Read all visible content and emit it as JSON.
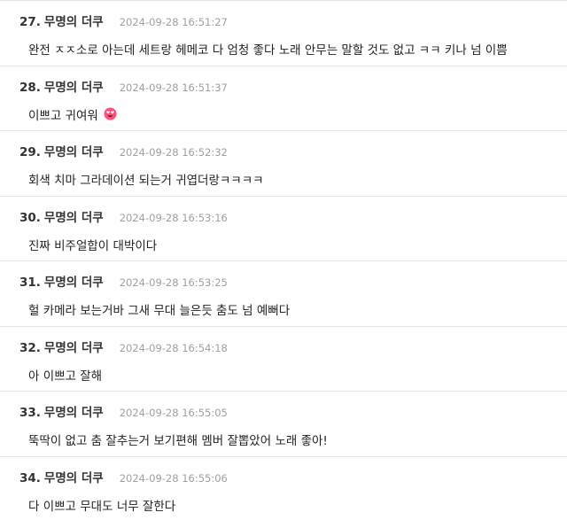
{
  "comments": [
    {
      "number": "27.",
      "author": "무명의 더쿠",
      "date": "2024-09-28 16:51:27",
      "text": "완전 ㅈㅈ소로 아는데 세트랑 헤메코 다 엄청 좋다 노래 안무는 말할 것도 없고 ㅋㅋ 키나 넘 이쁨",
      "emoji": null
    },
    {
      "number": "28.",
      "author": "무명의 더쿠",
      "date": "2024-09-28 16:51:37",
      "text": "이쁘고 귀여워",
      "emoji": "heart-eyes-emoji-icon"
    },
    {
      "number": "29.",
      "author": "무명의 더쿠",
      "date": "2024-09-28 16:52:32",
      "text": "회색 치마 그라데이션 되는거 귀엽더랑ㅋㅋㅋㅋ",
      "emoji": null
    },
    {
      "number": "30.",
      "author": "무명의 더쿠",
      "date": "2024-09-28 16:53:16",
      "text": "진짜 비주얼합이 대박이다",
      "emoji": null
    },
    {
      "number": "31.",
      "author": "무명의 더쿠",
      "date": "2024-09-28 16:53:25",
      "text": "헐 카메라 보는거바 그새 무대 늘은듯 춤도 넘 예뻐다",
      "emoji": null
    },
    {
      "number": "32.",
      "author": "무명의 더쿠",
      "date": "2024-09-28 16:54:18",
      "text": "아 이쁘고 잘해",
      "emoji": null
    },
    {
      "number": "33.",
      "author": "무명의 더쿠",
      "date": "2024-09-28 16:55:05",
      "text": "뚝딱이 없고 춤 잘추는거 보기편해 멤버 잘뽑았어 노래 좋아!",
      "emoji": null
    },
    {
      "number": "34.",
      "author": "무명의 더쿠",
      "date": "2024-09-28 16:55:06",
      "text": "다 이쁘고 무대도 너무 잘한다",
      "emoji": null
    }
  ],
  "colors": {
    "emoji_face": "#ff4f7a",
    "emoji_heart": "#fff1f4"
  }
}
